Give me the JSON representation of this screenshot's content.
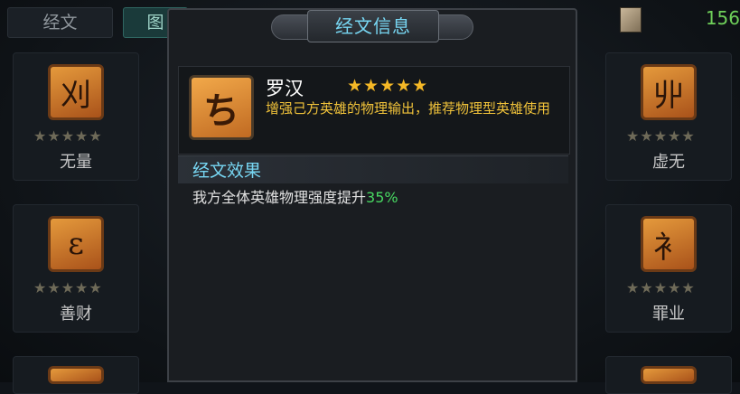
{
  "tabs": {
    "sutra": "经文",
    "illustrated": "图"
  },
  "currency": {
    "value": "156",
    "color": "#6fd05a"
  },
  "cards": [
    {
      "name": "无量",
      "glyph": "刈",
      "stars": 5
    },
    {
      "name": "善财",
      "glyph": "ɛ",
      "stars": 5
    },
    {
      "name": "虚无",
      "glyph": "丱",
      "stars": 5
    },
    {
      "name": "罪业",
      "glyph": "衤",
      "stars": 5
    }
  ],
  "modal": {
    "title": "经文信息",
    "rune": {
      "icon_glyph": "ち",
      "name": "罗汉",
      "stars": 5,
      "stars_text": "★★★★★",
      "description": "增强己方英雄的物理输出，推荐物理型英雄使用"
    },
    "effect": {
      "header": "经文效果",
      "text": "我方全体英雄物理强度提升",
      "value": "35%"
    }
  },
  "colors": {
    "star_active": "#f5b826",
    "title": "#77d6f2",
    "desc": "#f0c23a",
    "highlight": "#48d862"
  }
}
